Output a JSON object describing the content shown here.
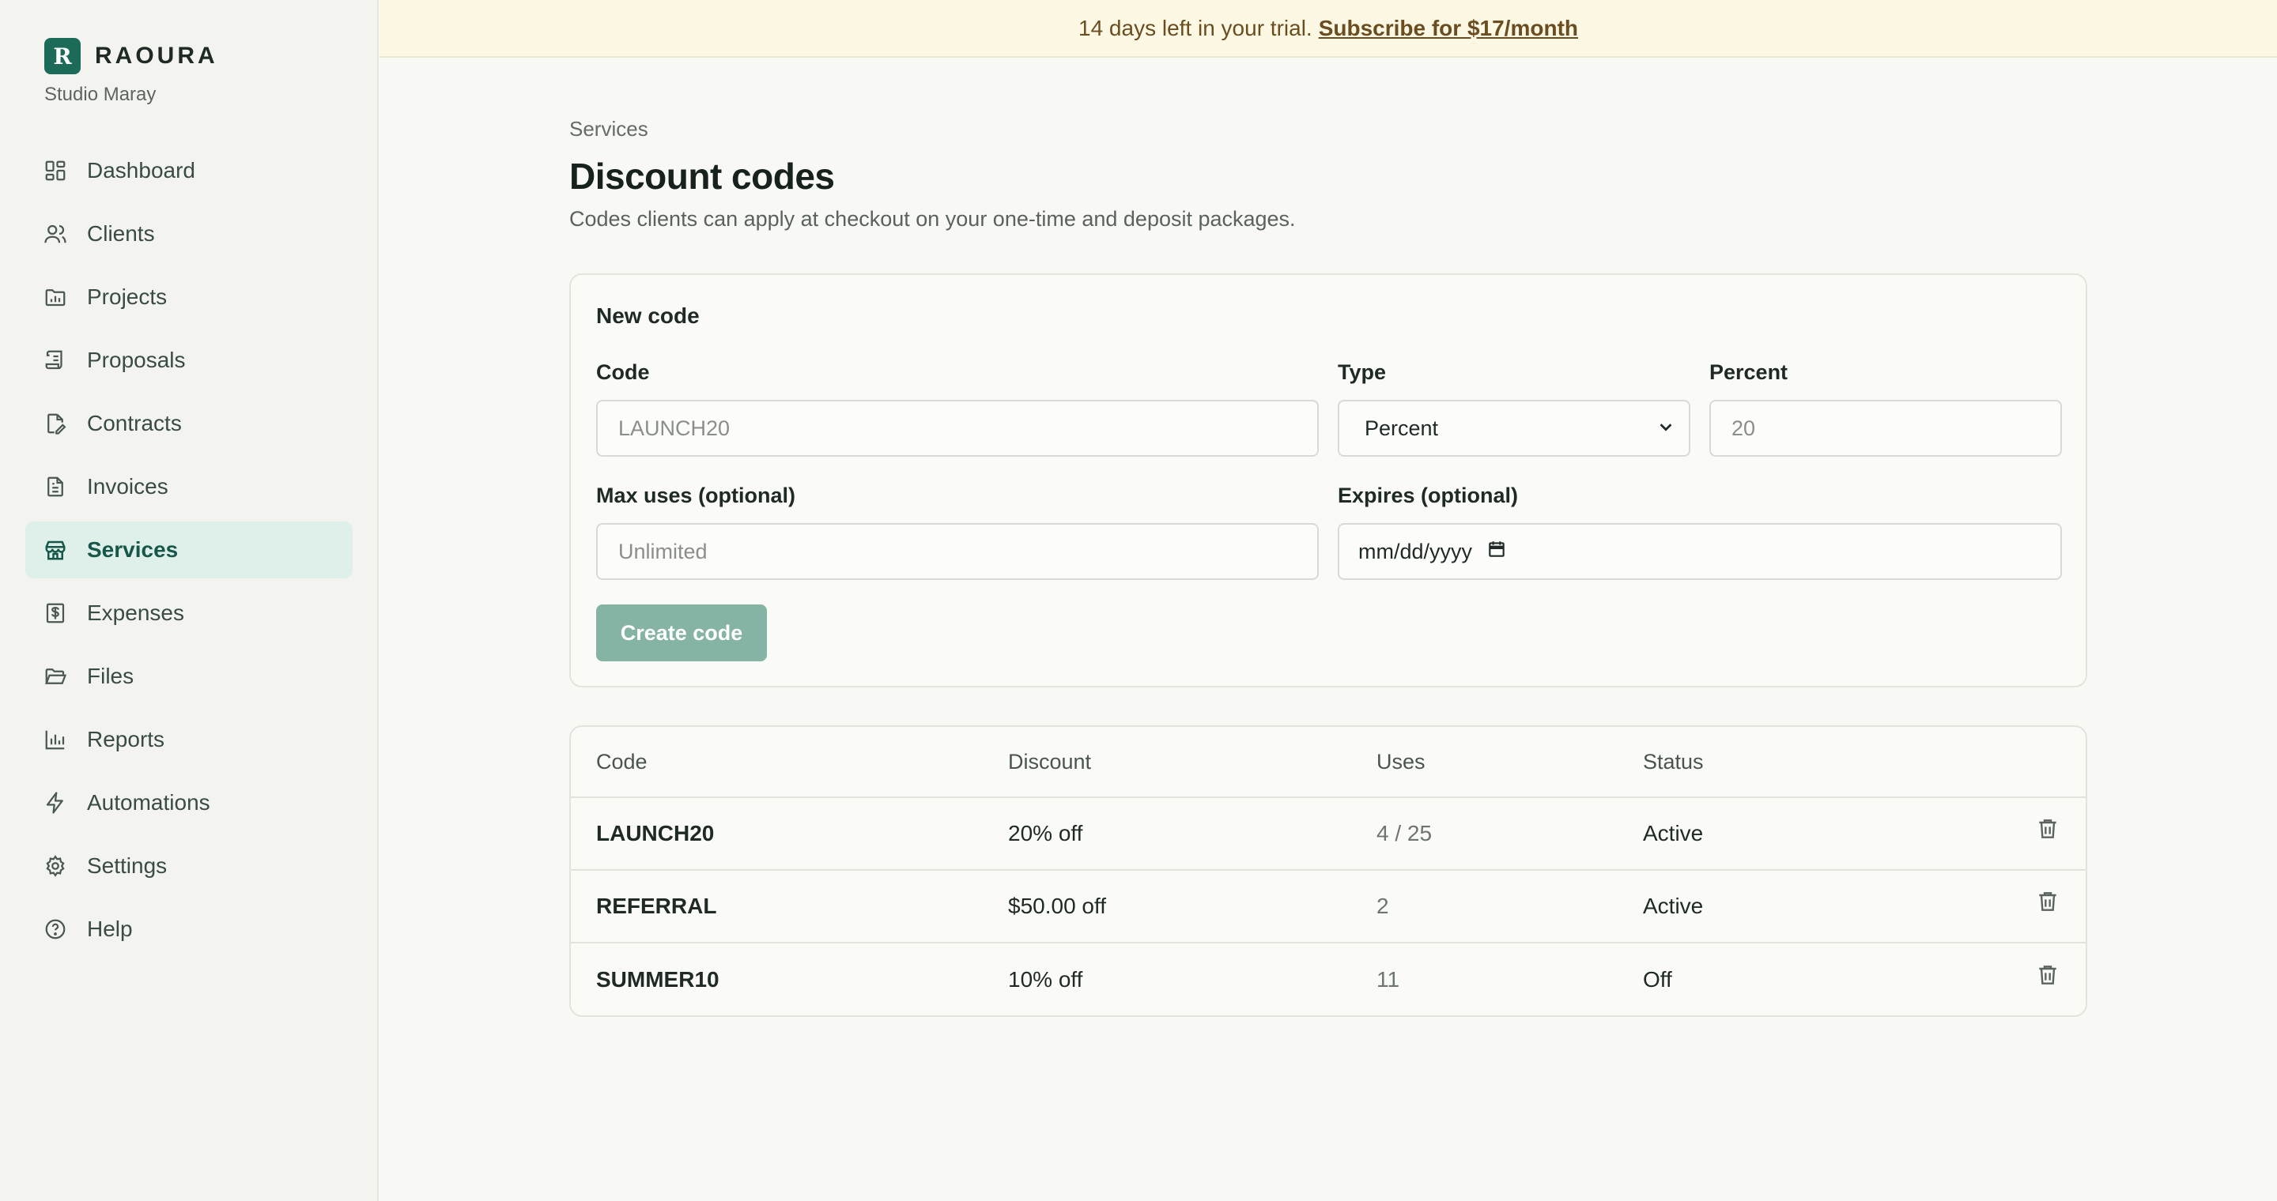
{
  "brand": {
    "logo_letter": "R",
    "name": "RAOURA",
    "workspace": "Studio Maray"
  },
  "sidebar": {
    "items": [
      {
        "label": "Dashboard",
        "icon": "dashboard-icon"
      },
      {
        "label": "Clients",
        "icon": "users-icon"
      },
      {
        "label": "Projects",
        "icon": "folder-chart-icon"
      },
      {
        "label": "Proposals",
        "icon": "scroll-icon"
      },
      {
        "label": "Contracts",
        "icon": "file-pen-icon"
      },
      {
        "label": "Invoices",
        "icon": "file-text-icon"
      },
      {
        "label": "Services",
        "icon": "store-icon",
        "active": true
      },
      {
        "label": "Expenses",
        "icon": "receipt-icon"
      },
      {
        "label": "Files",
        "icon": "folder-open-icon"
      },
      {
        "label": "Reports",
        "icon": "bar-chart-icon"
      },
      {
        "label": "Automations",
        "icon": "zap-icon"
      },
      {
        "label": "Settings",
        "icon": "gear-icon"
      },
      {
        "label": "Help",
        "icon": "help-circle-icon"
      }
    ]
  },
  "banner": {
    "text": "14 days left in your trial.",
    "link": "Subscribe for $17/month"
  },
  "page": {
    "breadcrumb": "Services",
    "title": "Discount codes",
    "subtitle": "Codes clients can apply at checkout on your one-time and deposit packages."
  },
  "form": {
    "title": "New code",
    "code_label": "Code",
    "code_placeholder": "LAUNCH20",
    "type_label": "Type",
    "type_value": "Percent",
    "percent_label": "Percent",
    "percent_placeholder": "20",
    "max_uses_label": "Max uses (optional)",
    "max_uses_placeholder": "Unlimited",
    "expires_label": "Expires (optional)",
    "expires_value": "mm/dd/yyyy",
    "create_label": "Create code"
  },
  "table": {
    "headers": {
      "code": "Code",
      "discount": "Discount",
      "uses": "Uses",
      "status": "Status"
    },
    "rows": [
      {
        "code": "LAUNCH20",
        "discount": "20% off",
        "uses": "4 / 25",
        "status": "Active"
      },
      {
        "code": "REFERRAL",
        "discount": "$50.00 off",
        "uses": "2",
        "status": "Active"
      },
      {
        "code": "SUMMER10",
        "discount": "10% off",
        "uses": "11",
        "status": "Off"
      }
    ]
  },
  "colors": {
    "accent": "#1c6b58",
    "active_nav_bg": "#dff0ea",
    "banner_bg": "#fcf8e3",
    "button_bg": "#85b3a4"
  }
}
